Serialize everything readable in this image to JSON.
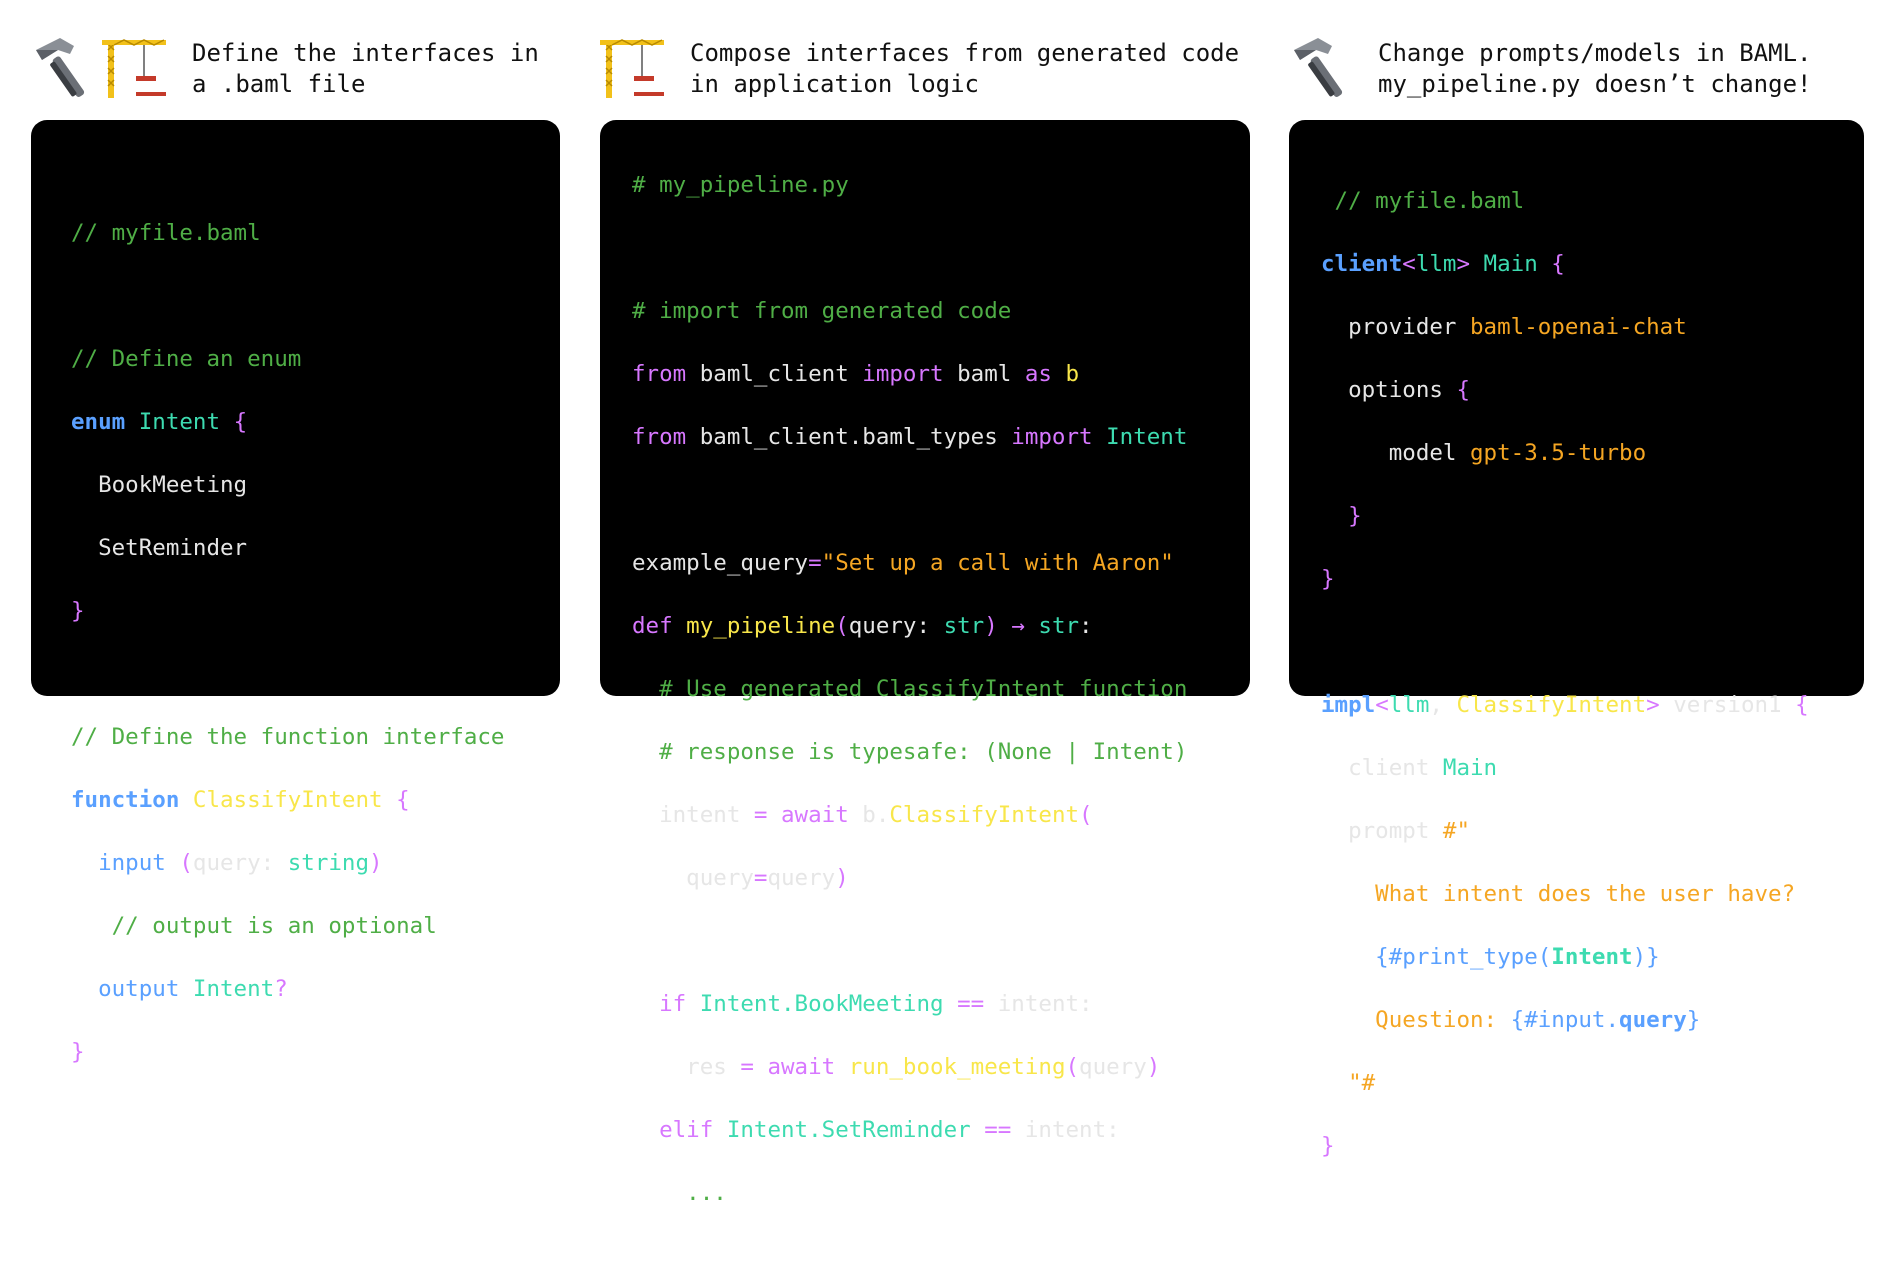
{
  "headers": [
    {
      "line1": "Define the interfaces in",
      "line2": "a .baml file",
      "icons": [
        "hammer-icon",
        "crane-icon"
      ]
    },
    {
      "line1": "Compose interfaces from generated code",
      "line2": "in application logic",
      "icons": [
        "crane-icon"
      ]
    },
    {
      "line1": "Change prompts/models in BAML.",
      "line2": "my_pipeline.py doesn’t change!",
      "icons": [
        "hammer-icon"
      ]
    }
  ],
  "colors": {
    "comment": "#4fae46",
    "keyword": "#5aa0ff",
    "pink": "#d777ff",
    "teal": "#3ddbb0",
    "yellow": "#f8e64a",
    "orange": "#f5a623"
  },
  "panel1": {
    "l1": "// myfile.baml",
    "l3": "// Define an enum",
    "l4_kw": "enum",
    "l4_name": "Intent",
    "l4_brace": "{",
    "l5": "  BookMeeting",
    "l6": "  SetReminder",
    "l7": "}",
    "l9": "// Define the function interface",
    "l10_kw": "function",
    "l10_name": "ClassifyIntent",
    "l10_brace": "{",
    "l11_a": "  input",
    "l11_b": " (",
    "l11_c": "query: ",
    "l11_d": "string",
    "l11_e": ")",
    "l12": "   // output is an optional",
    "l13_a": "  output",
    "l13_b": " Intent",
    "l13_c": "?",
    "l14": "}"
  },
  "panel2": {
    "l1": "# my_pipeline.py",
    "l3": "# import from generated code",
    "l4_a": "from",
    "l4_b": " baml_client ",
    "l4_c": "import",
    "l4_d": " baml ",
    "l4_e": "as",
    "l4_f": " b",
    "l5_a": "from",
    "l5_b": " baml_client.baml_types ",
    "l5_c": "import",
    "l5_d": " Intent",
    "l7_a": "example_query",
    "l7_b": "=",
    "l7_c": "\"Set up a call with Aaron\"",
    "l8_a": "def",
    "l8_b": " my_pipeline",
    "l8_c": "(",
    "l8_d": "query: ",
    "l8_e": "str",
    "l8_f": ")",
    "l8_g": " → ",
    "l8_h": "str",
    "l8_i": ":",
    "l9": "  # Use generated ClassifyIntent function",
    "l10": "  # response is typesafe: (None | Intent)",
    "l11_a": "  intent ",
    "l11_b": "= ",
    "l11_c": "await",
    "l11_d": " b.",
    "l11_e": "ClassifyIntent",
    "l11_f": "(",
    "l12_a": "    query",
    "l12_b": "=",
    "l12_c": "query",
    "l12_d": ")",
    "l14_a": "  if",
    "l14_b": " Intent.BookMeeting",
    "l14_c": " == ",
    "l14_d": "intent:",
    "l15_a": "    res ",
    "l15_b": "= ",
    "l15_c": "await",
    "l15_d": " run_book_meeting",
    "l15_e": "(",
    "l15_f": "query",
    "l15_g": ")",
    "l16_a": "  elif",
    "l16_b": " Intent.SetReminder",
    "l16_c": " == ",
    "l16_d": "intent:",
    "l17": "    ..."
  },
  "panel3": {
    "l1": " // myfile.baml",
    "l2_a": "client",
    "l2_b": "<",
    "l2_c": "llm",
    "l2_d": ">",
    "l2_e": " Main",
    "l2_f": " {",
    "l3_a": "  provider ",
    "l3_b": "baml-openai-chat",
    "l4_a": "  options ",
    "l4_b": "{",
    "l5_a": "     model ",
    "l5_b": "gpt-3.5-turbo",
    "l6": "  }",
    "l7": "}",
    "l9_a": "impl",
    "l9_b": "<",
    "l9_c": "llm",
    "l9_d": ", ",
    "l9_e": "ClassifyIntent",
    "l9_f": ">",
    "l9_g": " version1",
    "l9_h": " {",
    "l10_a": "  client",
    "l10_b": " Main",
    "l11_a": "  prompt ",
    "l11_b": "#\"",
    "l12": "    What intent does the user have?",
    "l13_a": "    {#print_type(",
    "l13_b": "Intent",
    "l13_c": ")}",
    "l14_a": "    Question: ",
    "l14_b": "{#input.",
    "l14_c": "query",
    "l14_d": "}",
    "l15": "  \"#",
    "l16": "}"
  }
}
